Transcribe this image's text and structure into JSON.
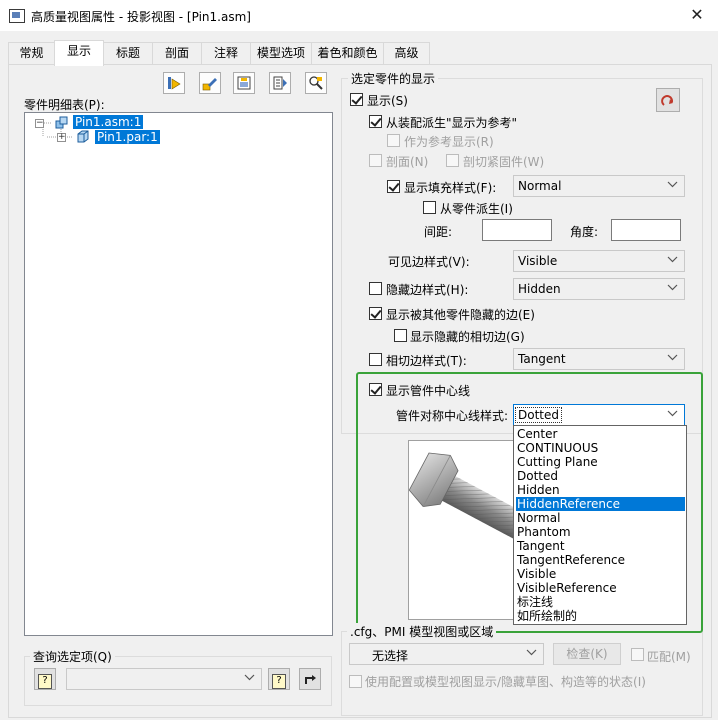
{
  "window": {
    "title": "高质量视图属性 - 投影视图 - [Pin1.asm]",
    "close_glyph": "✕"
  },
  "tabs": [
    {
      "label": "常规"
    },
    {
      "label": "显示"
    },
    {
      "label": "标题"
    },
    {
      "label": "剖面"
    },
    {
      "label": "注释"
    },
    {
      "label": "模型选项"
    },
    {
      "label": "着色和颜色"
    },
    {
      "label": "高级"
    }
  ],
  "active_tab": "显示",
  "toolbar_icons": [
    "show-part-icon",
    "pencil-icon",
    "properties-icon",
    "list-icon",
    "zoom-icon"
  ],
  "parts_list": {
    "label": "零件明细表(P):",
    "nodes": [
      {
        "label": "Pin1.asm:1",
        "expander": "−",
        "selected": true
      },
      {
        "label": "Pin1.par:1",
        "expander": "+",
        "selected": true
      }
    ]
  },
  "query": {
    "group_title": "查询选定项(Q)",
    "help_glyph": "?",
    "combo_value": ""
  },
  "selected_display": {
    "group_title": "选定零件的显示",
    "show": {
      "label": "显示(S)",
      "checked": true
    },
    "derive_from_assembly": {
      "label": "从装配派生\"显示为参考\"",
      "checked": true
    },
    "as_reference": {
      "label": "作为参考显示(R)",
      "checked": false,
      "enabled": false
    },
    "section": {
      "label": "剖面(N)",
      "checked": false,
      "enabled": false
    },
    "section_fastener": {
      "label": "剖切紧固件(W)",
      "checked": false,
      "enabled": false
    },
    "fill_style": {
      "label": "显示填充样式(F):",
      "checked": true,
      "value": "Normal"
    },
    "derive_from_part": {
      "label": "从零件派生(I)",
      "checked": false
    },
    "spacing_label": "间距:",
    "angle_label": "角度:",
    "visible_edge": {
      "label": "可见边样式(V):",
      "value": "Visible"
    },
    "hidden_edge": {
      "label": "隐藏边样式(H):",
      "checked": false,
      "value": "Hidden"
    },
    "show_hidden_by_others": {
      "label": "显示被其他零件隐藏的边(E)",
      "checked": true
    },
    "show_hidden_tangent": {
      "label": "显示隐藏的相切边(G)",
      "checked": false
    },
    "tangent_edge": {
      "label": "相切边样式(T):",
      "checked": false,
      "value": "Tangent"
    },
    "show_tube_centerline": {
      "label": "显示管件中心线",
      "checked": true
    },
    "tube_centerline_style": {
      "label": "管件对称中心线样式:",
      "value": "Dotted"
    }
  },
  "dropdown_options": [
    "Center",
    "CONTINUOUS",
    "Cutting Plane",
    "Dotted",
    "Hidden",
    "HiddenReference",
    "Normal",
    "Phantom",
    "Tangent",
    "TangentReference",
    "Visible",
    "VisibleReference",
    "标注线",
    "如所绘制的"
  ],
  "dropdown_highlighted": "HiddenReference",
  "pmi": {
    "group_title": ".cfg、PMI 模型视图或区域",
    "combo_value": "无选择",
    "check_button": "检查(K)",
    "match": {
      "label": "匹配(M)",
      "checked": false,
      "enabled": false
    },
    "use_config": {
      "label": "使用配置或模型视图显示/隐藏草图、构造等的状态(I)",
      "checked": false,
      "enabled": false
    }
  },
  "colors": {
    "selection": "#0078d7",
    "highlight_box": "#3aa33a"
  }
}
